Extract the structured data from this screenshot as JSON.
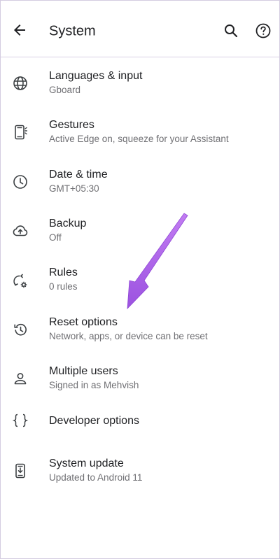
{
  "header": {
    "title": "System",
    "back_icon": "arrow-back-icon",
    "search_icon": "search-icon",
    "help_icon": "help-icon"
  },
  "items": [
    {
      "label": "Languages & input",
      "sub": "Gboard",
      "icon": "globe-icon"
    },
    {
      "label": "Gestures",
      "sub": "Active Edge on, squeeze for your Assistant",
      "icon": "phone-gesture-icon"
    },
    {
      "label": "Date & time",
      "sub": "GMT+05:30",
      "icon": "clock-icon"
    },
    {
      "label": "Backup",
      "sub": "Off",
      "icon": "cloud-upload-icon"
    },
    {
      "label": "Rules",
      "sub": "0 rules",
      "icon": "rules-icon"
    },
    {
      "label": "Reset options",
      "sub": "Network, apps, or device can be reset",
      "icon": "history-icon"
    },
    {
      "label": "Multiple users",
      "sub": "Signed in as Mehvish",
      "icon": "person-icon"
    },
    {
      "label": "Developer options",
      "sub": "",
      "icon": "braces-icon"
    },
    {
      "label": "System update",
      "sub": "Updated to Android 11",
      "icon": "system-update-icon"
    }
  ],
  "annotation": {
    "arrow_color": "#a25ee6",
    "arrow_icon": "pointer-arrow-icon"
  }
}
